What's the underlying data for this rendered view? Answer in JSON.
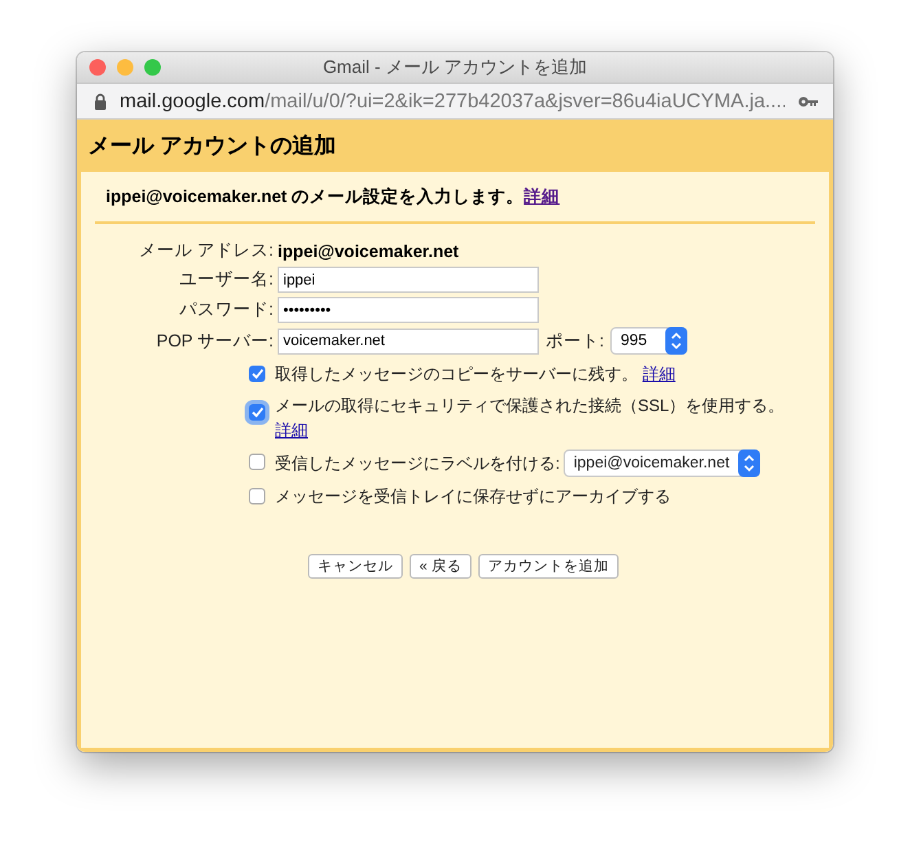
{
  "window": {
    "title": "Gmail - メール アカウントを追加"
  },
  "url": {
    "host": "mail.google.com",
    "path": "/mail/u/0/?ui=2&ik=277b42037a&jsver=86u4iaUCYMA.ja...."
  },
  "header": {
    "title": "メール アカウントの追加"
  },
  "intro": {
    "text": "ippei@voicemaker.net のメール設定を入力します。",
    "link": "詳細"
  },
  "fields": [
    {
      "kind": "static",
      "label": "メール アドレス:",
      "value": "ippei@voicemaker.net"
    },
    {
      "kind": "input",
      "label": "ユーザー名:",
      "value": "ippei"
    },
    {
      "kind": "input",
      "label": "パスワード:",
      "value": "•••••••••"
    },
    {
      "kind": "server",
      "label": "POP サーバー:",
      "value": "voicemaker.net",
      "port_label": "ポート:",
      "port": "995"
    }
  ],
  "options": [
    {
      "kind": "link",
      "label": "取得したメッセージのコピーをサーバーに残す。",
      "link": "詳細",
      "checked": true,
      "focused": false
    },
    {
      "kind": "link",
      "label": "メールの取得にセキュリティで保護された接続（SSL）を使用する。",
      "link": "詳細",
      "checked": true,
      "focused": true
    },
    {
      "kind": "select",
      "label": "受信したメッセージにラベルを付ける:",
      "select": "ippei@voicemaker.net",
      "checked": false,
      "focused": false
    },
    {
      "kind": "plain",
      "label": "メッセージを受信トレイに保存せずにアーカイブする",
      "checked": false,
      "focused": false
    }
  ],
  "buttons": [
    "キャンセル",
    "« 戻る",
    "アカウントを追加"
  ]
}
